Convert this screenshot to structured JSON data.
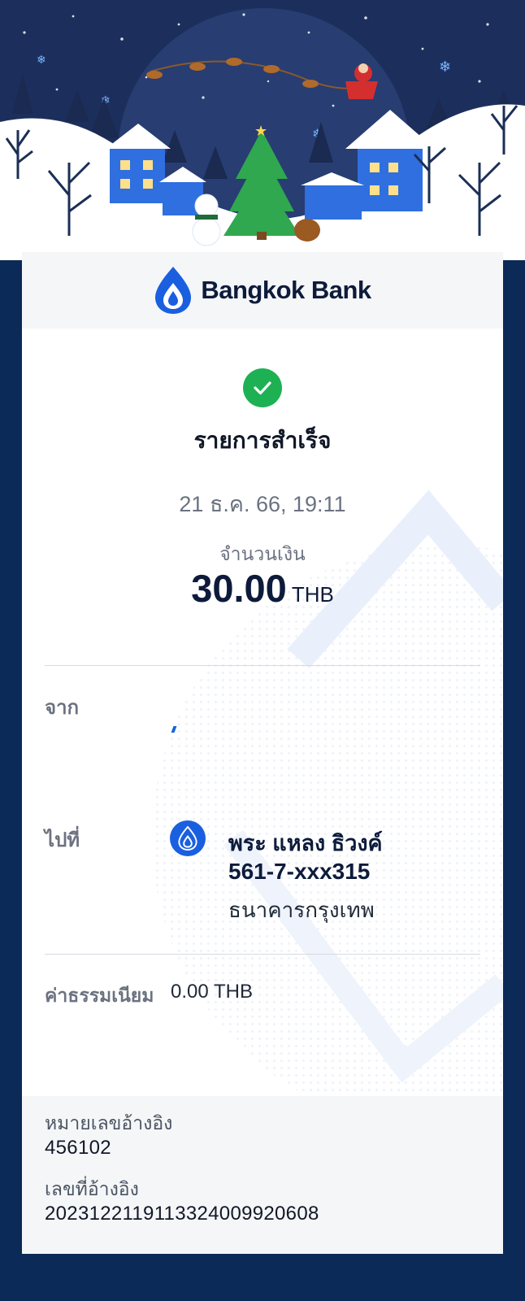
{
  "brand": {
    "name": "Bangkok Bank",
    "logo_icon": "lotus-logo-icon",
    "color": "#1a5fe0"
  },
  "banner": {
    "theme": "christmas-village-illustration"
  },
  "status": {
    "icon": "check-circle-icon",
    "title": "รายการสำเร็จ",
    "color": "#1eb154"
  },
  "transaction": {
    "datetime": "21 ธ.ค. 66, 19:11",
    "amount_label": "จำนวนเงิน",
    "amount": "30.00",
    "currency": "THB"
  },
  "from": {
    "label": "จาก"
  },
  "to": {
    "label": "ไปที่",
    "icon": "bank-logo-icon",
    "name": "พระ แหลง ธิวงค์",
    "account": "561-7-xxx315",
    "bank": "ธนาคารกรุงเทพ"
  },
  "fee": {
    "label": "ค่าธรรมเนียม",
    "value": "0.00 THB"
  },
  "reference": {
    "ref1_label": "หมายเลขอ้างอิง",
    "ref1_value": "456102",
    "ref2_label": "เลขที่อ้างอิง",
    "ref2_value": "2023122119113324009920608"
  },
  "colors": {
    "background": "#0c2a57",
    "card": "#ffffff",
    "panel": "#f5f6f8",
    "text_dark": "#0d1b3b"
  }
}
